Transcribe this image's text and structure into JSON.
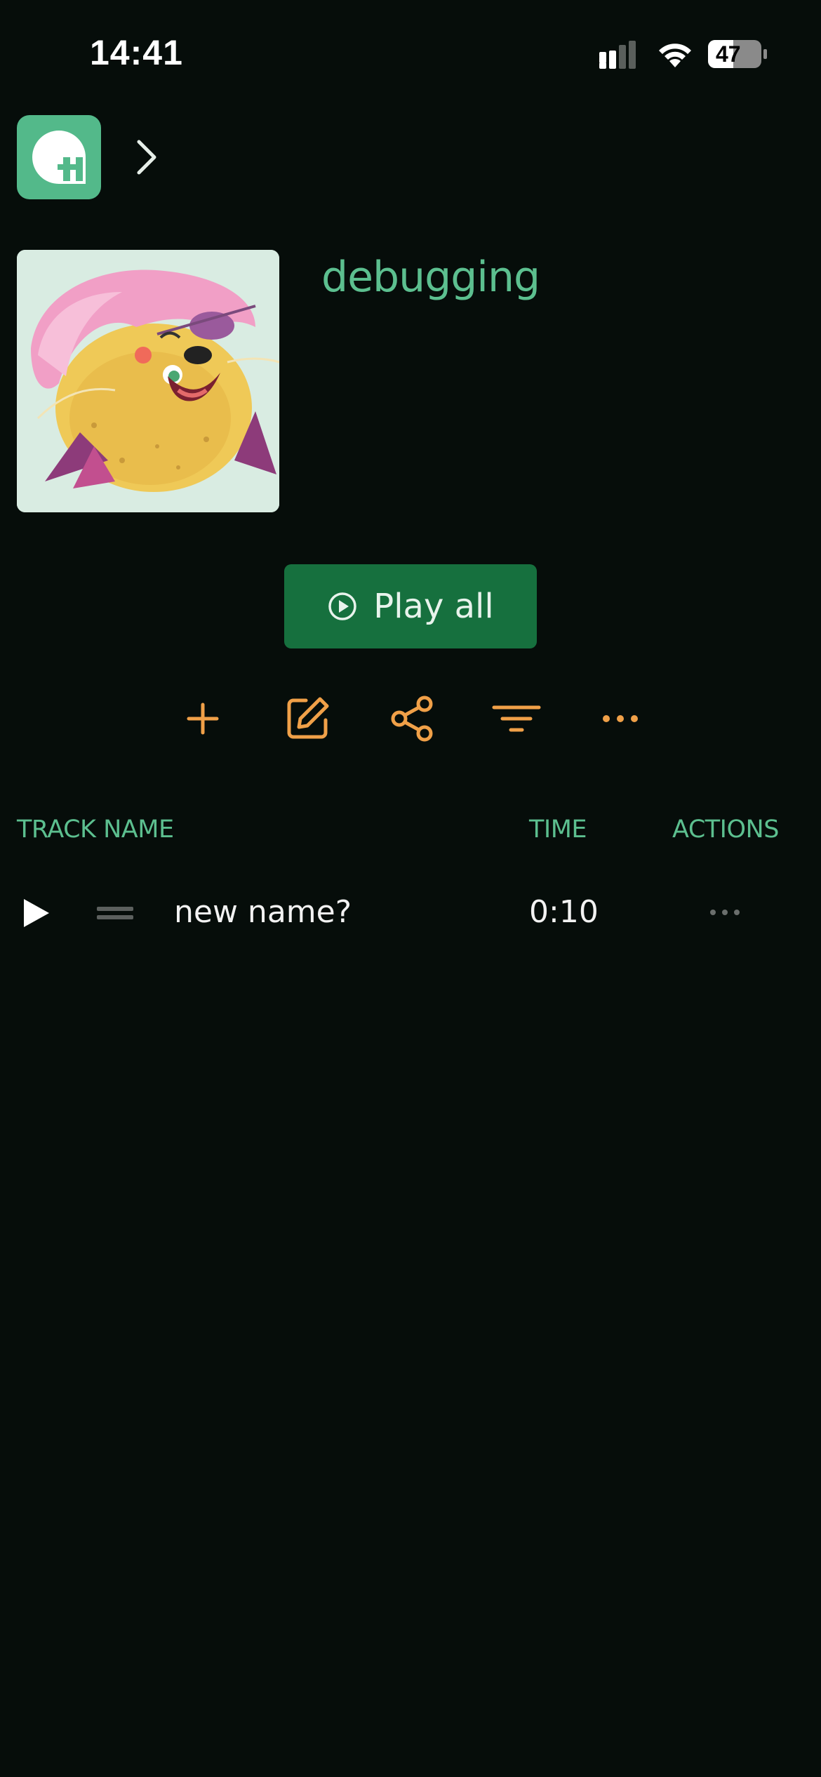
{
  "status_bar": {
    "time": "14:41",
    "battery_level": "47"
  },
  "header": {
    "logo_icon": "app-logo-icon",
    "breadcrumb_icon": "chevron-right-icon"
  },
  "playlist": {
    "title": "debugging",
    "cover_image": "cartoon-creature-cover-art"
  },
  "play_all": {
    "label": "Play all",
    "icon": "play-circle-icon"
  },
  "toolbar": {
    "items": [
      "plus-icon",
      "edit-icon",
      "share-icon",
      "filter-icon",
      "more-horizontal-icon"
    ]
  },
  "table": {
    "headers": {
      "name": "TRACK NAME",
      "time": "TIME",
      "actions": "ACTIONS"
    },
    "rows": [
      {
        "name": "new name?",
        "time": "0:10"
      }
    ]
  },
  "colors": {
    "background": "#060d0a",
    "accent_green": "#5cbf8f",
    "button_green": "#16703e",
    "accent_orange": "#f0a048"
  }
}
